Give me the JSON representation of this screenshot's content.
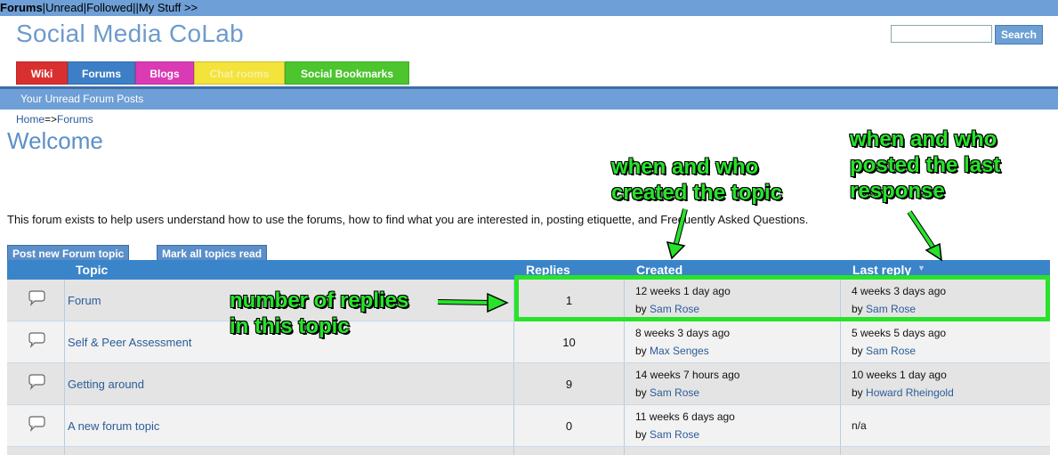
{
  "topnav": {
    "forums": "Forums",
    "unread": "Unread",
    "followed": "Followed",
    "mystuff": "My Stuff >>"
  },
  "site": {
    "title": "Social Media CoLab"
  },
  "search": {
    "placeholder": "",
    "button": "Search"
  },
  "tabs": [
    {
      "label": "Wiki",
      "color": "#d9302f"
    },
    {
      "label": "Forums",
      "color": "#3d7fc6"
    },
    {
      "label": "Blogs",
      "color": "#db3ab5"
    },
    {
      "label": "Chat rooms",
      "color": "#f3e33a"
    },
    {
      "label": "Social Bookmarks",
      "color": "#4cc52f"
    }
  ],
  "subnav": {
    "label": "Your Unread Forum Posts"
  },
  "breadcrumb": {
    "home": "Home",
    "sep": "=>",
    "forums": "Forums"
  },
  "page": {
    "title": "Welcome",
    "intro": "This forum exists to help users understand how to use the forums, how to find what you are interested in, posting etiquette, and Frequently Asked Questions."
  },
  "actions": {
    "post_new": "Post new Forum topic",
    "mark_read": "Mark all topics read"
  },
  "table": {
    "headers": {
      "topic": "Topic",
      "replies": "Replies",
      "created": "Created",
      "last_reply": "Last reply"
    },
    "rows": [
      {
        "topic": "Forum",
        "replies": "1",
        "created_when": "12 weeks 1 day ago",
        "created_by": "Sam Rose",
        "last_when": "4 weeks 3 days ago",
        "last_by": "Sam Rose"
      },
      {
        "topic": "Self & Peer Assessment",
        "replies": "10",
        "created_when": "8 weeks 3 days ago",
        "created_by": "Max Senges",
        "last_when": "5 weeks 5 days ago",
        "last_by": "Sam Rose"
      },
      {
        "topic": "Getting around",
        "replies": "9",
        "created_when": "14 weeks 7 hours ago",
        "created_by": "Sam Rose",
        "last_when": "10 weeks 1 day ago",
        "last_by": "Howard Rheingold"
      },
      {
        "topic": "A new forum topic",
        "replies": "0",
        "created_when": "11 weeks 6 days ago",
        "created_by": "Sam Rose",
        "last_when": "n/a",
        "last_by": ""
      }
    ],
    "by": "by"
  },
  "annotations": {
    "replies": [
      "number of replies",
      "in this topic"
    ],
    "created": [
      "when and who",
      "created the topic"
    ],
    "last": [
      "when and who",
      "posted the last",
      "response"
    ]
  }
}
